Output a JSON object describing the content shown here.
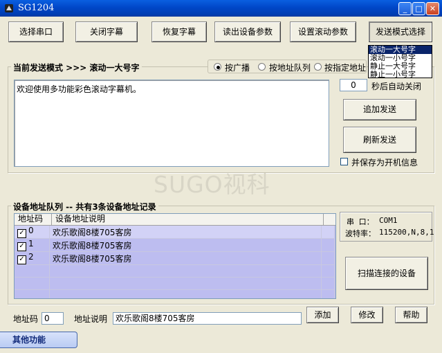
{
  "window": {
    "title": "SG1204"
  },
  "toolbar": {
    "select_port": "选择串口",
    "close_subtitle": "关闭字幕",
    "restore_subtitle": "恢复字幕",
    "read_params": "读出设备参数",
    "set_scroll_params": "设置滚动参数",
    "send_mode_select": "发送模式选择"
  },
  "send_mode_dropdown": {
    "options": [
      "滚动一大号字",
      "滚动一小号字",
      "静止一大号字",
      "静止一小号字"
    ],
    "selected_index": 0
  },
  "send_section": {
    "legend": "当前发送模式 >>> 滚动一大号字",
    "radios": [
      "按广播",
      "按地址队列",
      "按指定地址"
    ],
    "selected_radio": 0,
    "message": "欢迎使用多功能彩色滚动字幕机。",
    "auto_close_seconds": "0",
    "auto_close_label": "秒后自动关闭",
    "append_send": "追加发送",
    "refresh_send": "刷新发送",
    "save_as_boot": "并保存为开机信息",
    "save_as_boot_checked": false
  },
  "watermark": "SUGO视科",
  "address_section": {
    "legend": "设备地址队列 -- 共有3条设备地址记录",
    "columns": [
      "地址码",
      "设备地址说明"
    ],
    "rows": [
      {
        "code": "0",
        "desc": "欢乐歌阁8楼705客房",
        "checked": true
      },
      {
        "code": "1",
        "desc": "欢乐歌阁8楼705客房",
        "checked": true
      },
      {
        "code": "2",
        "desc": "欢乐歌阁8楼705客房",
        "checked": true
      }
    ],
    "empty_rows": 4
  },
  "serial_info": {
    "port_label": "串 口：",
    "port_value": "COM1",
    "baud_label": "波特率：",
    "baud_value": "115200,N,8,1"
  },
  "scan_button": "扫描连接的设备",
  "bottom": {
    "addr_code_label": "地址码",
    "addr_code_value": "0",
    "addr_desc_label": "地址说明",
    "addr_desc_value": "欢乐歌阁8楼705客房",
    "add": "添加",
    "modify": "修改",
    "help": "帮助"
  },
  "footer": {
    "other_functions": "其他功能"
  }
}
